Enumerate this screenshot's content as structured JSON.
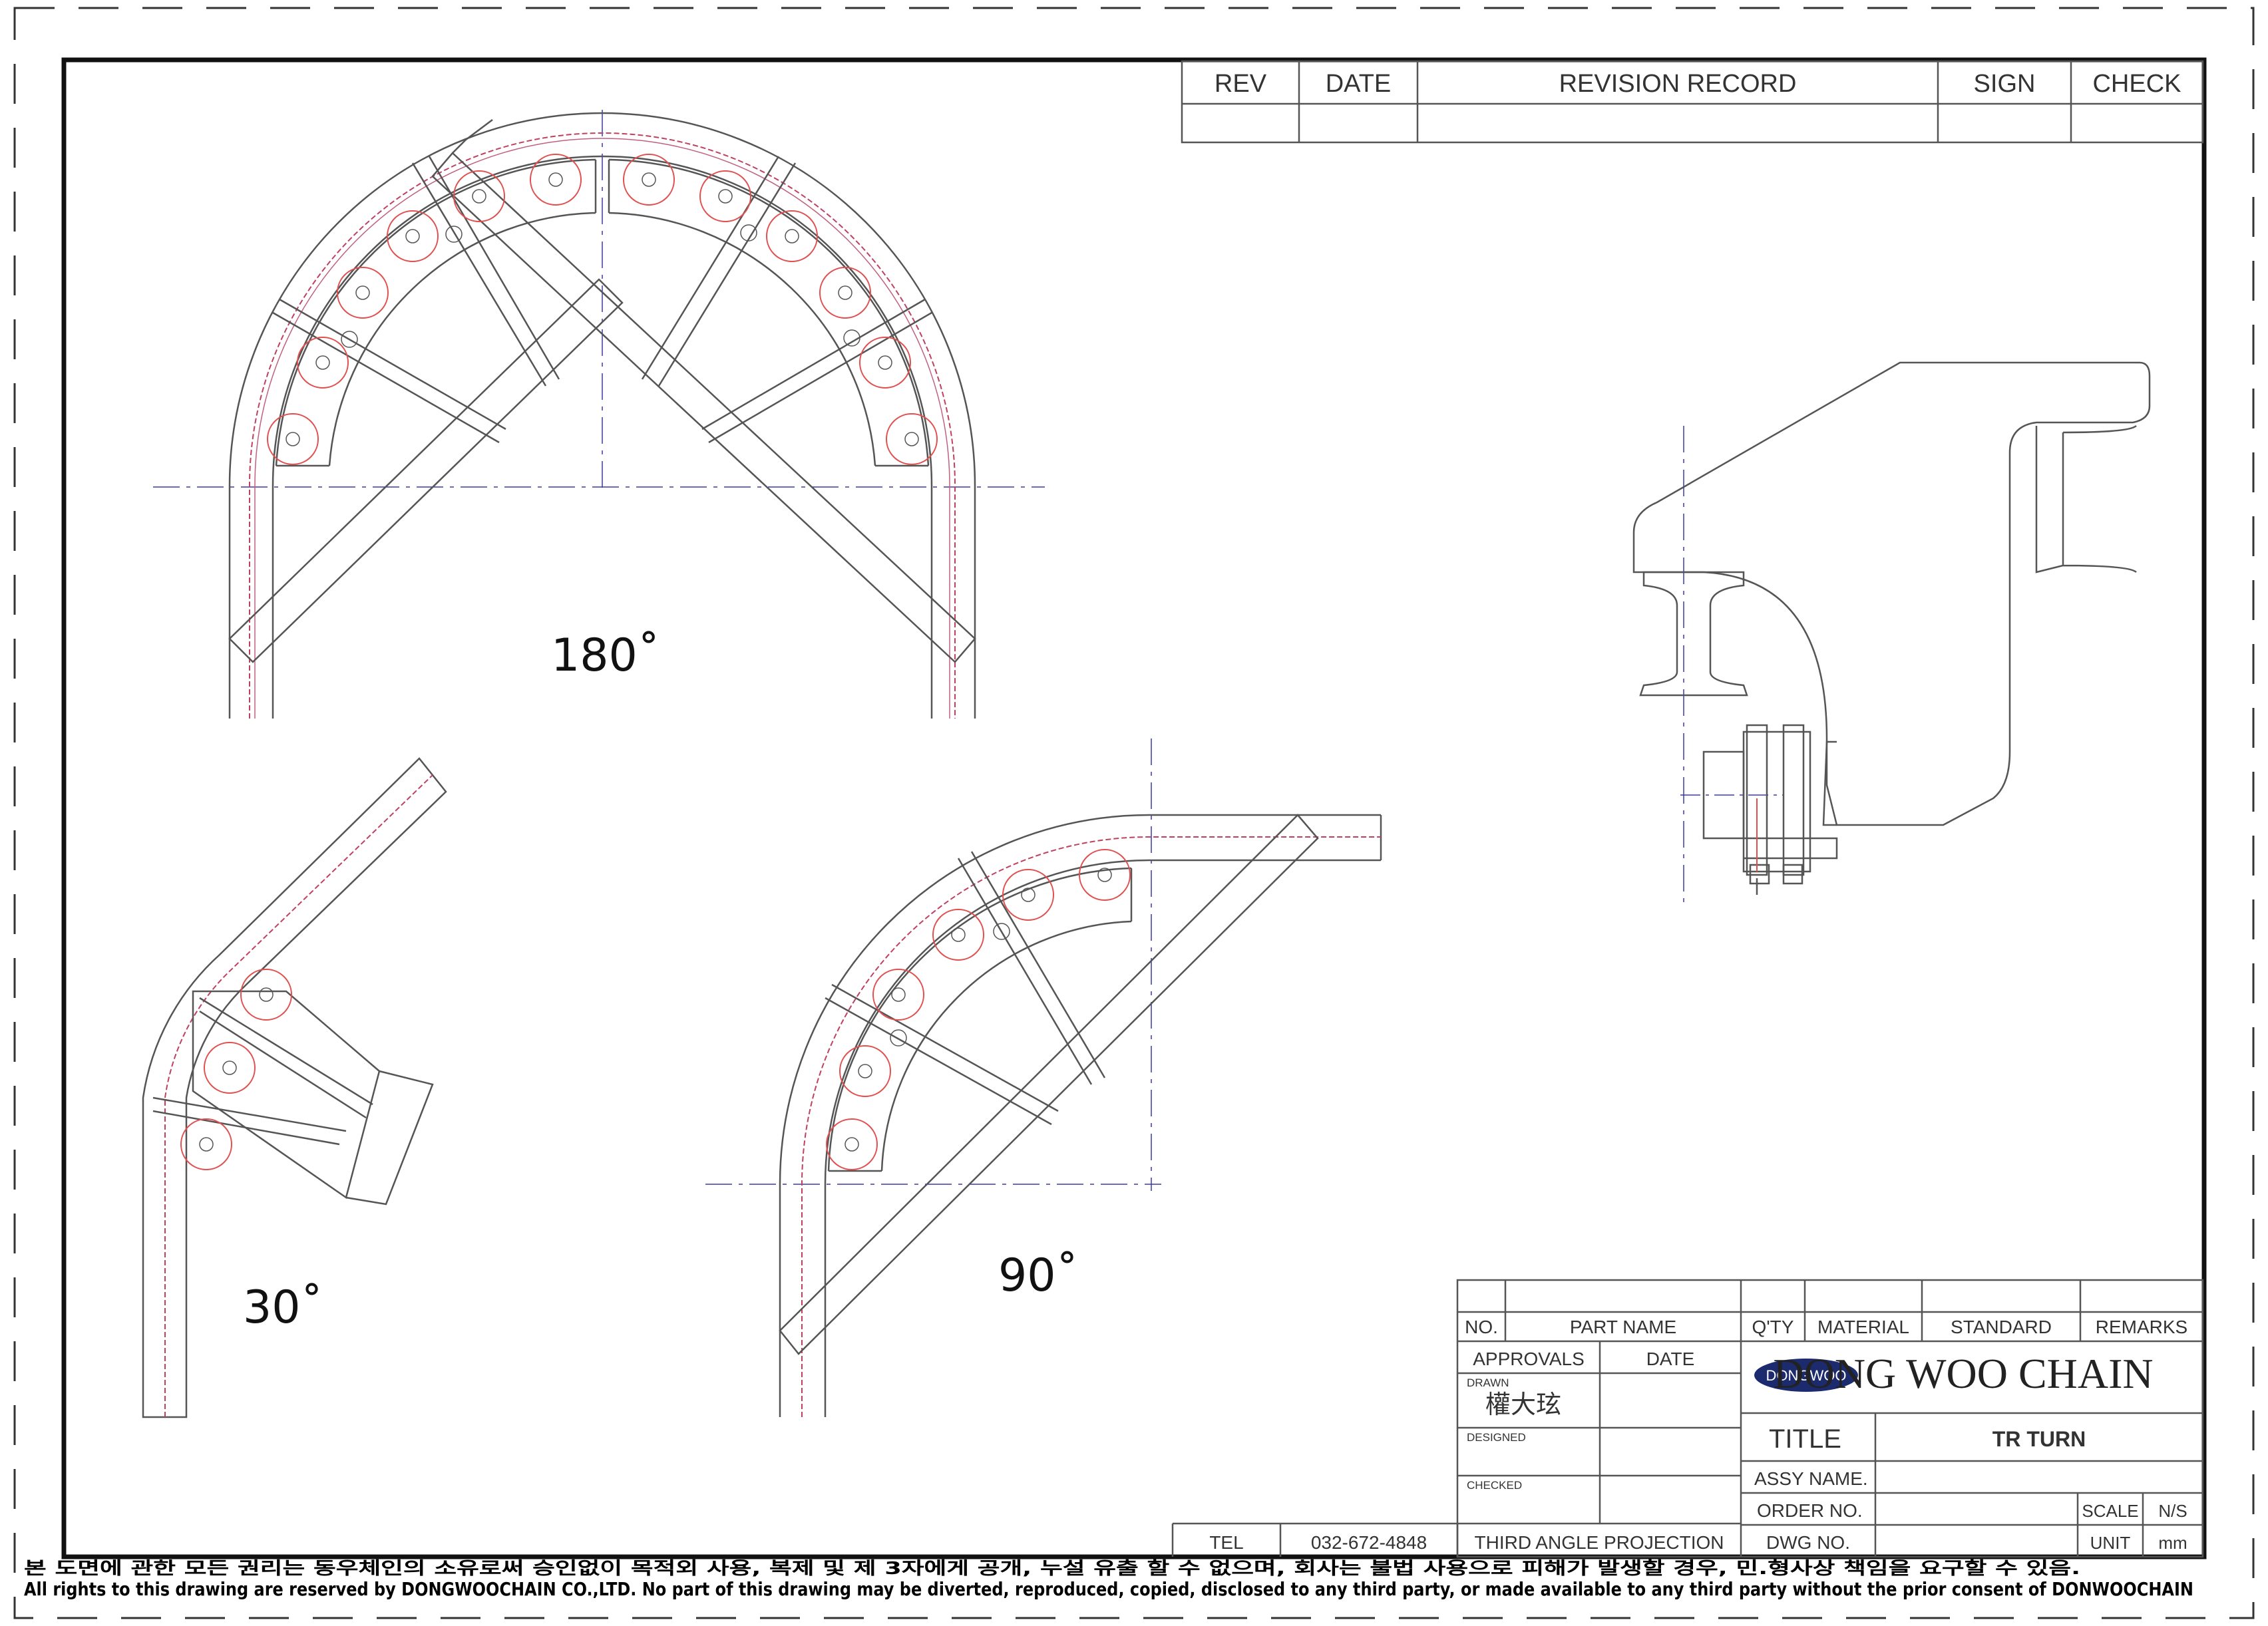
{
  "revision_table": {
    "headers": [
      "REV",
      "DATE",
      "REVISION RECORD",
      "SIGN",
      "CHECK"
    ]
  },
  "views": {
    "angle_180": "180˚",
    "angle_30": "30˚",
    "angle_90": "90˚"
  },
  "parts_table": {
    "headers": [
      "NO.",
      "PART NAME",
      "Q'TY",
      "MATERIAL",
      "STANDARD",
      "REMARKS"
    ]
  },
  "approvals": {
    "header_approvals": "APPROVALS",
    "header_date": "DATE",
    "drawn_label": "DRAWN",
    "drawn_name": "權大玹",
    "designed_label": "DESIGNED",
    "checked_label": "CHECKED"
  },
  "company": {
    "logo_text": "DONGWOO",
    "name": "DONG WOO CHAIN",
    "logo_color": "#1c2a6e"
  },
  "title_block": {
    "title_label": "TITLE",
    "title_value": "TR TURN",
    "assy_label": "ASSY NAME.",
    "order_label": "ORDER NO.",
    "scale_label": "SCALE",
    "scale_value": "N/S",
    "dwg_label": "DWG NO.",
    "unit_label": "UNIT",
    "unit_value": "mm"
  },
  "footer_row": {
    "tel_label": "TEL",
    "tel_value": "032-672-4848",
    "projection": "THIRD ANGLE PROJECTION"
  },
  "notice": {
    "korean": "본 도면에 관한 모든 권리는 동우체인의 소유로써 승인없이 목적외 사용, 복제 및 제 3자에게 공개, 누설 유출 할 수 없으며,  회사는 불법 사용으로 피해가 발생할 경우, 민.형사상 책임을 요구할 수 있음.",
    "english": "All rights to this drawing are reserved by DONGWOOCHAIN CO.,LTD. No part of this drawing may be diverted, reproduced, copied, disclosed to any third party, or made available to any third party without the prior consent of DONWOOCHAIN"
  },
  "colors": {
    "line": "#555555",
    "red": "#e05050",
    "center": "#3a3aa0"
  }
}
